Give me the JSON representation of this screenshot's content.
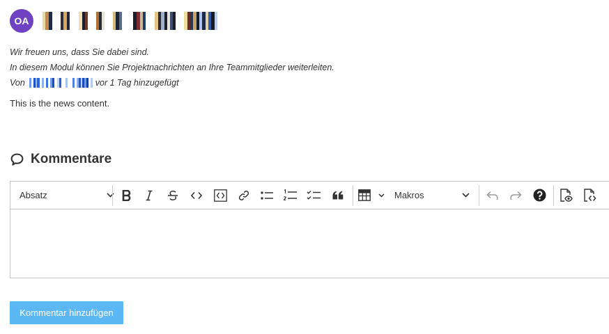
{
  "header": {
    "avatar_initials": "OA",
    "avatar_color": "#6f42c1"
  },
  "post": {
    "intro_line1": "Wir freuen uns, dass Sie dabei sind.",
    "intro_line2": "In diesem Modul können Sie Projektnachrichten an Ihre Teammitglieder weiterleiten.",
    "by_prefix": "Von",
    "by_suffix": "vor 1 Tag hinzugefügt",
    "content": "This is the news content."
  },
  "comments": {
    "heading": "Kommentare",
    "toolbar": {
      "paragraph_dropdown": "Absatz",
      "macros_dropdown": "Makros",
      "icons": [
        "bold-icon",
        "italic-icon",
        "strikethrough-icon",
        "code-icon",
        "code-block-icon",
        "link-icon",
        "bulleted-list-icon",
        "numbered-list-icon",
        "todo-list-icon",
        "quote-icon",
        "table-icon",
        "undo-icon",
        "redo-icon",
        "help-icon",
        "preview-icon",
        "source-icon"
      ]
    },
    "submit_label": "Kommentar hinzufügen",
    "submit_color": "#5bb8f5"
  }
}
